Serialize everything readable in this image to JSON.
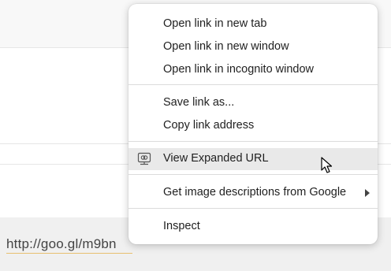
{
  "page": {
    "link_text": "http://goo.gl/m9bn"
  },
  "context_menu": {
    "items": [
      {
        "label": "Open link in new tab"
      },
      {
        "label": "Open link in new window"
      },
      {
        "label": "Open link in incognito window"
      },
      {
        "label": "Save link as..."
      },
      {
        "label": "Copy link address"
      },
      {
        "label": "View Expanded URL",
        "icon": "network-link-icon",
        "highlighted": true
      },
      {
        "label": "Get image descriptions from Google",
        "submenu": true,
        "icon": "chevron-right-icon"
      },
      {
        "label": "Inspect"
      }
    ]
  },
  "colors": {
    "menu_background": "#ffffff",
    "highlight": "#e9e9e9",
    "separator": "#dcdcdc",
    "link_underline": "#e8c070"
  }
}
